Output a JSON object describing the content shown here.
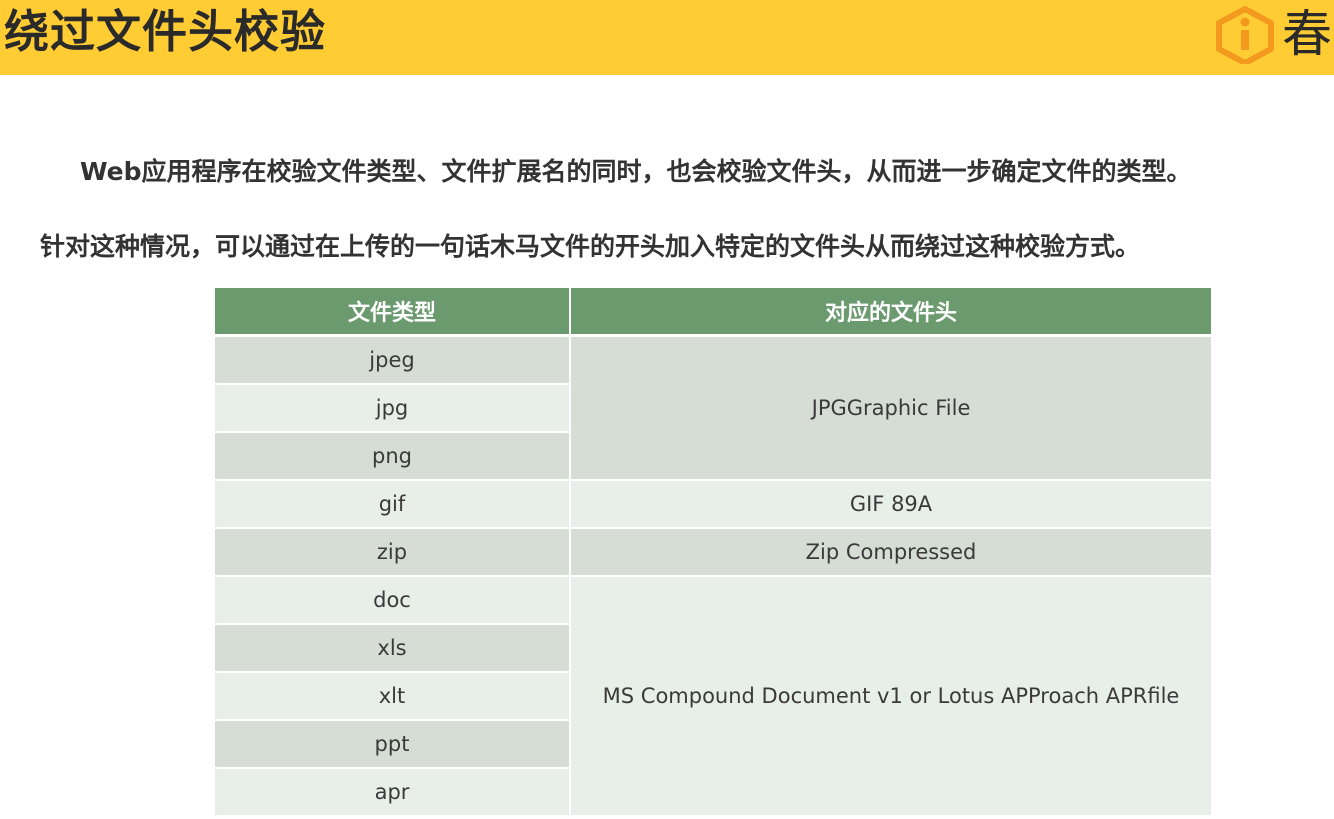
{
  "header": {
    "title": "绕过文件头校验",
    "logo_glyph": "春"
  },
  "intro": {
    "line1": "Web应用程序在校验文件类型、文件扩展名的同时，也会校验文件头，从而进一步确定文件的类型。",
    "line2": "针对这种情况，可以通过在上传的一句话木马文件的开头加入特定的文件头从而绕过这种校验方式。"
  },
  "table": {
    "headers": [
      "文件类型",
      "对应的文件头"
    ],
    "types": [
      "jpeg",
      "jpg",
      "png",
      "gif",
      "zip",
      "doc",
      "xls",
      "xlt",
      "ppt",
      "apr"
    ],
    "signatures": [
      "JPGGraphic File",
      "GIF 89A",
      "Zip Compressed",
      "MS Compound Document v1 or Lotus APProach APRfile"
    ]
  },
  "colors": {
    "header_bar": "#ffcc33",
    "table_header": "#6b9a6f",
    "row_dark": "#d5ddd5",
    "row_light": "#e8eee8",
    "logo_accent": "#f39a1e"
  }
}
